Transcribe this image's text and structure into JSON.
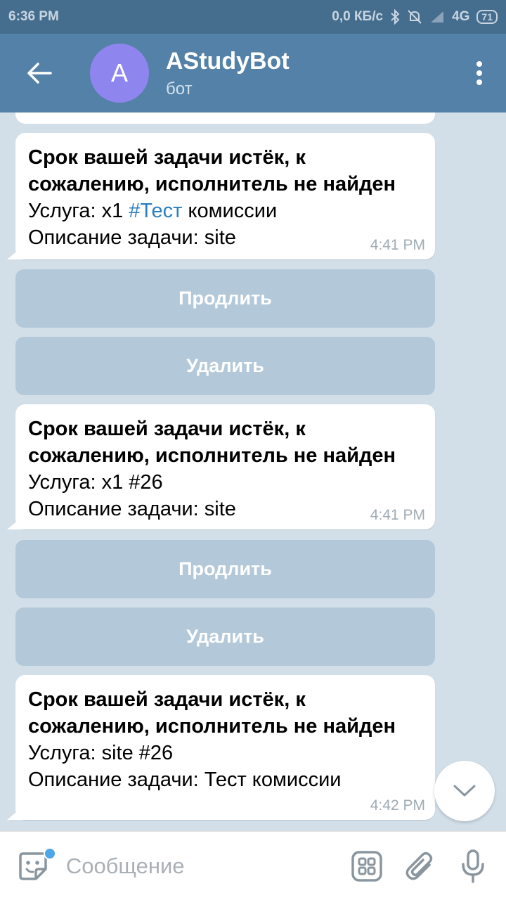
{
  "status_bar": {
    "time": "6:36 PM",
    "network_speed": "0,0 КБ/с",
    "network_type": "4G",
    "battery": "71",
    "icons": [
      "bluetooth-icon",
      "mute-icon",
      "signal-icon"
    ]
  },
  "header": {
    "avatar_letter": "A",
    "title": "AStudyBot",
    "subtitle": "бот",
    "avatar_color": "#8e85ee",
    "bar_color": "#5481a7"
  },
  "messages": [
    {
      "heading": "Срок вашей задачи истёк, к сожалению, исполнитель не найден",
      "service_prefix": "Услуга: x1 ",
      "service_hashtag": "#Тест",
      "service_suffix": " комиссии",
      "description": "Описание задачи: site",
      "time": "4:41 PM"
    },
    {
      "heading": "Срок вашей задачи истёк, к сожалению, исполнитель не найден",
      "service": "Услуга: x1 #26",
      "description": "Описание задачи: site",
      "time": "4:41 PM"
    },
    {
      "heading": "Срок вашей задачи истёк, к сожалению, исполнитель не найден",
      "service": "Услуга: site #26",
      "description": "Описание задачи: Тест комиссии",
      "time": "4:42 PM"
    }
  ],
  "keyboard": {
    "extend_label": "Продлить",
    "delete_label": "Удалить"
  },
  "input": {
    "placeholder": "Сообщение",
    "value": ""
  },
  "colors": {
    "hashtag": "#2a7fc1",
    "chat_background": "#d2dfe9",
    "keyboard_button": "#b3c8d8"
  }
}
